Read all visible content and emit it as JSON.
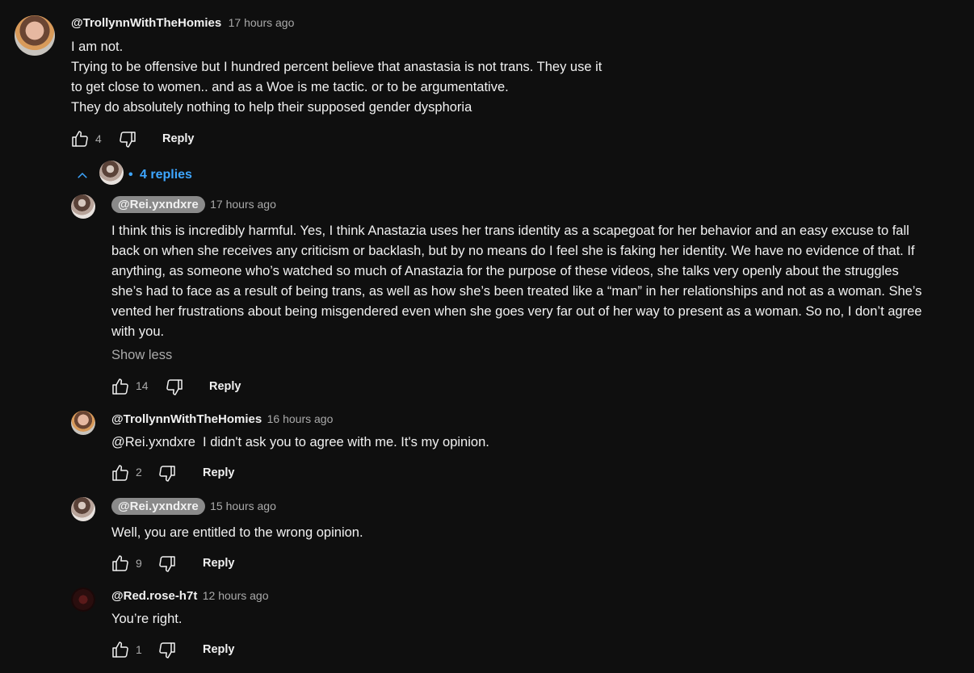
{
  "main": {
    "author": "@TrollynnWithTheHomies",
    "time": "17 hours ago",
    "lines": [
      "I am not.",
      "Trying to be offensive but I hundred percent believe that anastasia is not trans. They use it",
      "to get close to women.. and as a Woe is me tactic. or to be argumentative.",
      "They do absolutely nothing to help their supposed gender dysphoria"
    ],
    "likes": "4",
    "reply_label": "Reply"
  },
  "replies_toggle": {
    "bullet": "•",
    "label": "4 replies"
  },
  "replies": [
    {
      "author": "@Rei.yxndxre",
      "time": "17 hours ago",
      "lines": [
        "I think this is incredibly harmful. Yes, I think Anastazia uses her trans identity as a scapegoat for her behavior and an easy excuse to fall",
        "back on when she receives any criticism or backlash, but by no means do I feel she is faking her identity. We have no evidence of that. If",
        "anything, as someone who’s watched so much of Anastazia for the purpose of these videos, she talks very openly about the struggles",
        "she’s had to face as a result of being trans, as well as how she’s been treated like a “man” in her relationships and not as a woman. She’s",
        "vented her frustrations about being misgendered even when she goes very far out of her way to present as a woman. So no, I don’t agree",
        "with you."
      ],
      "show_less": "Show less",
      "likes": "14",
      "reply_label": "Reply"
    },
    {
      "author": "@TrollynnWithTheHomies",
      "time": "16 hours ago",
      "text": "@Rei.yxndxre  I didn't ask you to agree with me. It's my opinion.",
      "likes": "2",
      "reply_label": "Reply"
    },
    {
      "author": "@Rei.yxndxre",
      "time": "15 hours ago",
      "text": "Well, you are entitled to the wrong opinion.",
      "likes": "9",
      "reply_label": "Reply"
    },
    {
      "author": "@Red.rose-h7t",
      "time": "12 hours ago",
      "text": "You’re right.",
      "likes": "1",
      "reply_label": "Reply"
    }
  ],
  "icons": {
    "like": "thumb-up-icon",
    "dislike": "thumb-down-icon",
    "collapse": "chevron-up-icon"
  },
  "colors": {
    "background": "#0f0f0f",
    "text": "#f1f1f1",
    "muted": "#aaaaaa",
    "link": "#3ea6ff",
    "pill": "#8a8a8a"
  }
}
